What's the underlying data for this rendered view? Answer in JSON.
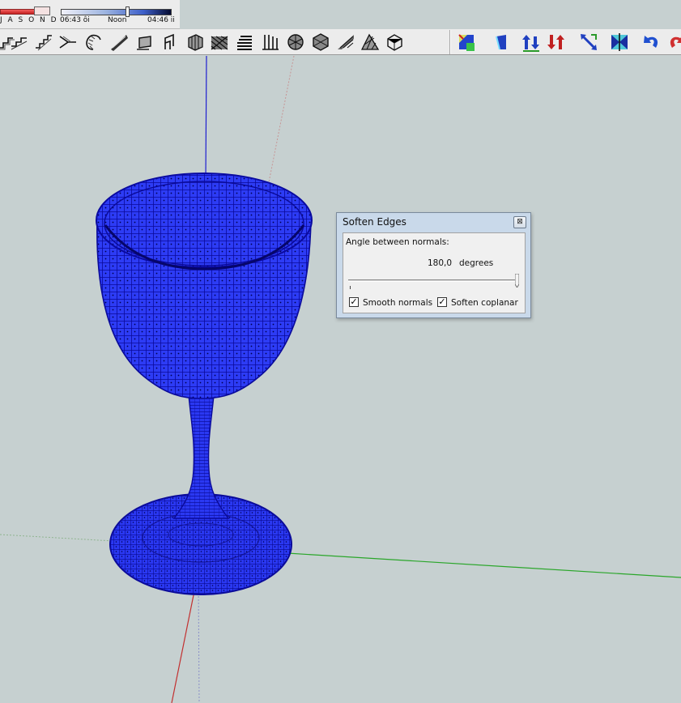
{
  "shadow_settings": {
    "months": "J A S O N D",
    "sunrise": "06:43 ôi",
    "noon": "Noon",
    "sunset": "04:46 ii"
  },
  "toolbar": {
    "tools": [
      "stair-tool-icon",
      "stair-tool-2-icon",
      "stair-tool-3-icon",
      "stair-tool-4-icon",
      "spiral-stair-icon",
      "ramp-icon",
      "roof-icon",
      "chair-icon",
      "cube-frame-icon",
      "lattice-icon",
      "stack-icon",
      "fence-icon",
      "circle-lattice-icon",
      "hex-lattice-icon",
      "slope-icon",
      "truss-icon",
      "box-icon"
    ],
    "right_tools": [
      "axes-select-icon",
      "stand-up-icon",
      "move-up-icon",
      "move-down-icon",
      "scale-icon",
      "mirror-icon",
      "undo-icon",
      "redo-icon"
    ]
  },
  "dialog": {
    "title": "Soften Edges",
    "angle_label": "Angle between normals:",
    "angle_value": "180,0",
    "angle_unit": "degrees",
    "slider_fraction": 1.0,
    "smooth_normals_label": "Smooth normals",
    "smooth_normals_checked": true,
    "soften_coplanar_label": "Soften coplanar",
    "soften_coplanar_checked": true,
    "close_symbol": "⊠"
  },
  "colors": {
    "viewport_bg": "#c6d0d0",
    "mesh": "#1a1aff",
    "axis_blue": "#2020d0",
    "axis_green": "#2aa62a",
    "axis_red": "#c23030",
    "dialog_frame": "#c9d9ea"
  }
}
